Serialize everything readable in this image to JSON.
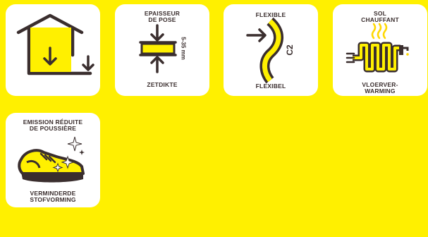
{
  "colors": {
    "background": "#FFF000",
    "tile": "#ffffff",
    "ink": "#3a2e2e",
    "accent_yellow": "#FFF000"
  },
  "tiles": [
    {
      "icon": "house-floor-icon",
      "top_label": "",
      "bottom_label": ""
    },
    {
      "icon": "layer-thickness-icon",
      "top_label": "EPAISSEUR\nDE POSE",
      "side_label": "5-35 mm",
      "bottom_label": "ZETDIKTE"
    },
    {
      "icon": "flexible-bend-icon",
      "top_label": "FLEXIBLE",
      "side_label": "C2",
      "bottom_label": "FLEXIBEL"
    },
    {
      "icon": "floor-heating-icon",
      "top_label": "SOL\nCHAUFFANT",
      "bottom_label": "VLOERVER-\nWARMING"
    },
    {
      "icon": "low-dust-shoe-icon",
      "top_label": "EMISSION RÉDUITE\nDE POUSSIÈRE",
      "bottom_label": "VERMINDERDE\nSTOFVORMING"
    }
  ]
}
